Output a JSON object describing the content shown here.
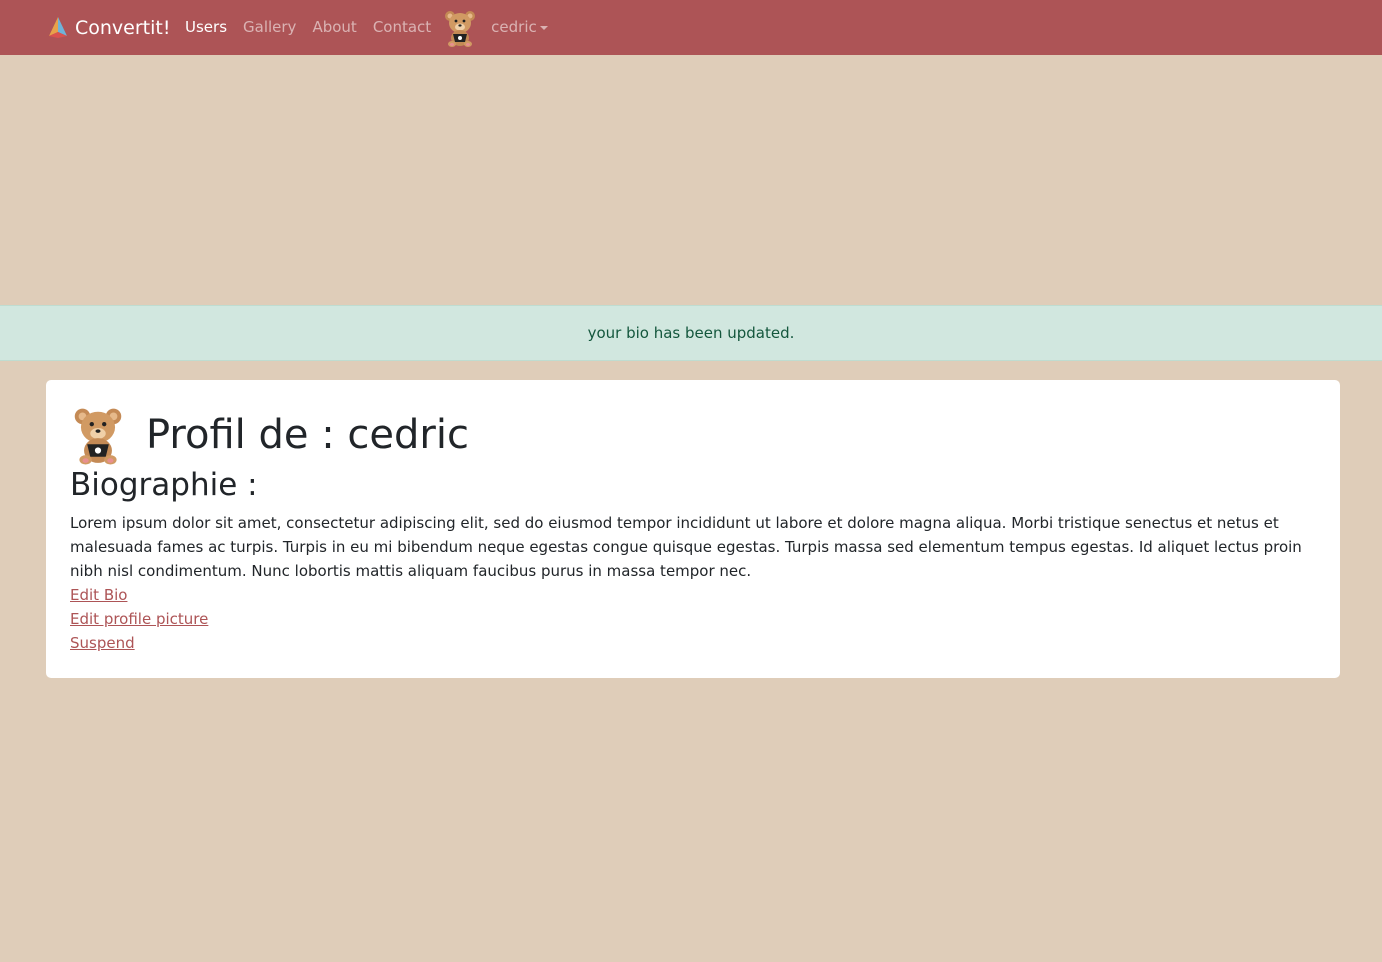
{
  "navbar": {
    "brand": "Convertit!",
    "links": [
      {
        "label": "Users",
        "active": true
      },
      {
        "label": "Gallery",
        "active": false
      },
      {
        "label": "About",
        "active": false
      },
      {
        "label": "Contact",
        "active": false
      }
    ],
    "user": "cedric"
  },
  "alert": {
    "message": "your bio has been updated."
  },
  "profile": {
    "title": "Profil de : cedric",
    "bio_heading": "Biographie :",
    "bio_text": "Lorem ipsum dolor sit amet, consectetur adipiscing elit, sed do eiusmod tempor incididunt ut labore et dolore magna aliqua. Morbi tristique senectus et netus et malesuada fames ac turpis. Turpis in eu mi bibendum neque egestas congue quisque egestas. Turpis massa sed elementum tempus egestas. Id aliquet lectus proin nibh nisl condimentum. Nunc lobortis mattis aliquam faucibus purus in massa tempor nec.",
    "actions": {
      "edit_bio": "Edit Bio",
      "edit_picture": "Edit profile picture",
      "suspend": "Suspend"
    }
  },
  "colors": {
    "navbar": "#ad5456",
    "page_background": "#dfcdb9",
    "alert_background": "#d1e7df",
    "alert_text": "#14573d",
    "link": "#ad5456"
  },
  "icons": {
    "brand": "paper-plane-logo-icon",
    "avatar": "teddy-bear-avatar-icon"
  }
}
